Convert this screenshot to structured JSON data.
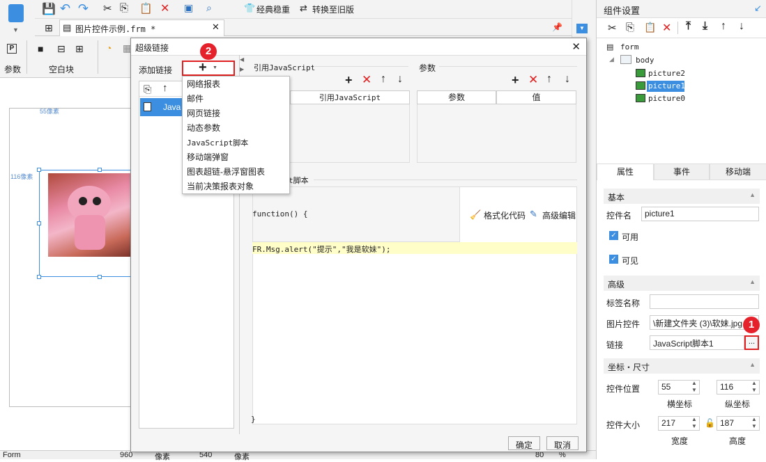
{
  "toolbar": {
    "classic_label": "经典稳重",
    "convert_label": "转换至旧版",
    "tab_file": "图片控件示例.frm *"
  },
  "ribbon": {
    "params_label": "参数",
    "blank_label": "空白块"
  },
  "canvas": {
    "hruler_text": "55像素",
    "vruler_text": "116像素"
  },
  "dialog": {
    "title": "超级链接",
    "add_link_label": "添加链接",
    "list_item": "Java...",
    "ref_js_label": "引用JavaScript",
    "ref_js_col": "引用JavaScript",
    "params_label": "参数",
    "params_col_name": "参数",
    "params_col_value": "值",
    "script_section": "t脚本",
    "func_open": "function() {",
    "format_code": "格式化代码",
    "advanced_edit": "高级编辑",
    "code_line": "FR.Msg.alert(\"提示\",\"我是软妹\");",
    "func_close": "}",
    "ok": "确定",
    "cancel": "取消",
    "dropdown": [
      "网络报表",
      "邮件",
      "网页链接",
      "动态参数",
      "JavaScript脚本",
      "移动端弹窗",
      "图表超链-悬浮窗图表",
      "当前决策报表对象"
    ]
  },
  "badges": {
    "one": "1",
    "two": "2"
  },
  "rpanel": {
    "title": "组件设置",
    "tree": {
      "form": "form",
      "body": "body",
      "items": [
        "picture2",
        "picture1",
        "picture0"
      ]
    },
    "tabs": [
      "属性",
      "事件",
      "移动端"
    ],
    "basic_section": "基本",
    "widget_name_label": "控件名",
    "widget_name_value": "picture1",
    "enabled_label": "可用",
    "visible_label": "可见",
    "advanced_section": "高级",
    "tag_name_label": "标签名称",
    "tag_name_value": "",
    "image_label": "图片控件",
    "image_value": "\\新建文件夹 (3)\\软妹.jpg",
    "link_label": "链接",
    "link_value": "JavaScript脚本1",
    "link_button": "...",
    "coord_section": "坐标・尺寸",
    "pos_label": "控件位置",
    "pos_x": "55",
    "pos_y": "116",
    "x_label": "横坐标",
    "y_label": "纵坐标",
    "size_label": "控件大小",
    "width": "217",
    "height": "187",
    "width_label": "宽度",
    "height_label": "高度"
  },
  "statusbar": {
    "form_label": "Form",
    "w": "960",
    "unit1": "像素",
    "h": "540",
    "unit2": "像素",
    "zoom": "80",
    "pct": "%"
  },
  "colors": {
    "accent": "#3c8fe0",
    "red": "#e02020",
    "selected": "#3c8fe0",
    "code_bg": "#fffdc8"
  }
}
